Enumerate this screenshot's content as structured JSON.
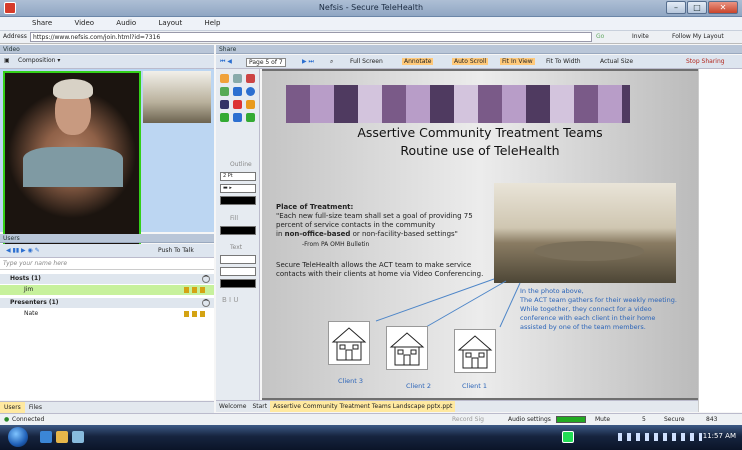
{
  "window": {
    "title": "Nefsis - Secure TeleHealth",
    "min": "–",
    "max": "□",
    "close": "✕"
  },
  "menu": [
    "Share",
    "Video",
    "Audio",
    "Layout",
    "Help"
  ],
  "address": {
    "label": "Address",
    "url": "https://www.nefsis.com/join.html?id=7316",
    "go": "Go",
    "invite": "Invite",
    "follow": "Follow My Layout"
  },
  "video": {
    "header": "Video",
    "composition": "Composition ▾"
  },
  "users": {
    "header": "Users",
    "push_to_talk": "Push To Talk",
    "filter_placeholder": "Type your name here",
    "groups": [
      {
        "label": "Hosts (1)",
        "users": [
          "Jim"
        ]
      },
      {
        "label": "Presenters (1)",
        "users": [
          "Nate"
        ]
      }
    ],
    "tabs": [
      "Users",
      "Files"
    ]
  },
  "share": {
    "header": "Share",
    "toolbar": {
      "page": "Page 5 of 7",
      "full_screen": "Full Screen",
      "annotate": "Annotate",
      "auto_scroll": "Auto Scroll",
      "fit_in_view": "Fit In View",
      "fit_to_width": "Fit To Width",
      "actual_size": "Actual Size",
      "stop_sharing": "Stop Sharing"
    },
    "tools": {
      "outline": "Outline",
      "outline_size": "2 Pt",
      "fill": "Fill",
      "text": "Text"
    },
    "slide": {
      "title1": "Assertive Community Treatment Teams",
      "title2": "Routine use of TeleHealth",
      "place_heading": "Place of Treatment:",
      "place_line1": "\"Each new full-size team shall set a goal of providing 75",
      "place_line2": "percent of service contacts in the community",
      "place_line3_a": "in ",
      "place_line3_b": "non-office-based",
      "place_line3_c": " or non-facility-based settings\"",
      "place_source": "-From PA OMH Bulletin",
      "secure_line1": "Secure TeleHealth allows the ACT team to make service",
      "secure_line2": "contacts with their clients at home via Video Conferencing.",
      "photo_caption": [
        "In the photo above,",
        "The ACT team gathers for their weekly meeting.",
        "While together, they connect for a video",
        "conference with each client in their home",
        "assisted by one of the team members."
      ],
      "clients": [
        "Client 3",
        "Client 2",
        "Client 1"
      ]
    },
    "doc_tabs": [
      "Welcome",
      "Start",
      "Assertive Community Treatment Teams Landscape pptx.ppt"
    ]
  },
  "status": {
    "connected": "Connected",
    "record": "Record Sig",
    "audio": "Audio settings",
    "mute": "Mute",
    "mic_count": "5",
    "secure": "Secure",
    "zoom": "843"
  },
  "taskbar": {
    "clock": "11:57 AM"
  },
  "colors": {
    "speaker_border": "#34d019",
    "selected_user": "#c7f19c",
    "tab_active": "#ffe9a0",
    "annotate_highlight": "#ffc97a",
    "caption_blue": "#2b64b8"
  }
}
